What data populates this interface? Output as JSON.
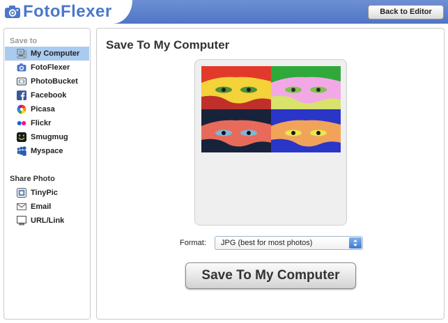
{
  "header": {
    "app_name": "FotoFlexer",
    "back_button_label": "Back to Editor",
    "brand_color": "#4f75c6"
  },
  "sidebar": {
    "save_to_label": "Save to",
    "save_items": [
      {
        "label": "My Computer",
        "icon": "computer-icon",
        "selected": true
      },
      {
        "label": "FotoFlexer",
        "icon": "fotoflexer-icon",
        "selected": false
      },
      {
        "label": "PhotoBucket",
        "icon": "photobucket-icon",
        "selected": false
      },
      {
        "label": "Facebook",
        "icon": "facebook-icon",
        "selected": false
      },
      {
        "label": "Picasa",
        "icon": "picasa-icon",
        "selected": false
      },
      {
        "label": "Flickr",
        "icon": "flickr-icon",
        "selected": false
      },
      {
        "label": "Smugmug",
        "icon": "smugmug-icon",
        "selected": false
      },
      {
        "label": "Myspace",
        "icon": "myspace-icon",
        "selected": false
      }
    ],
    "share_label": "Share Photo",
    "share_items": [
      {
        "label": "TinyPic",
        "icon": "tinypic-icon"
      },
      {
        "label": "Email",
        "icon": "email-icon"
      },
      {
        "label": "URL/Link",
        "icon": "link-icon"
      }
    ],
    "selected_color": "#a9cbf0"
  },
  "main": {
    "title": "Save To My Computer",
    "preview_image": "pop-art-portrait-thumbnail",
    "format_label": "Format:",
    "format_value": "JPG (best for most photos)",
    "save_button_label": "Save To My Computer"
  }
}
